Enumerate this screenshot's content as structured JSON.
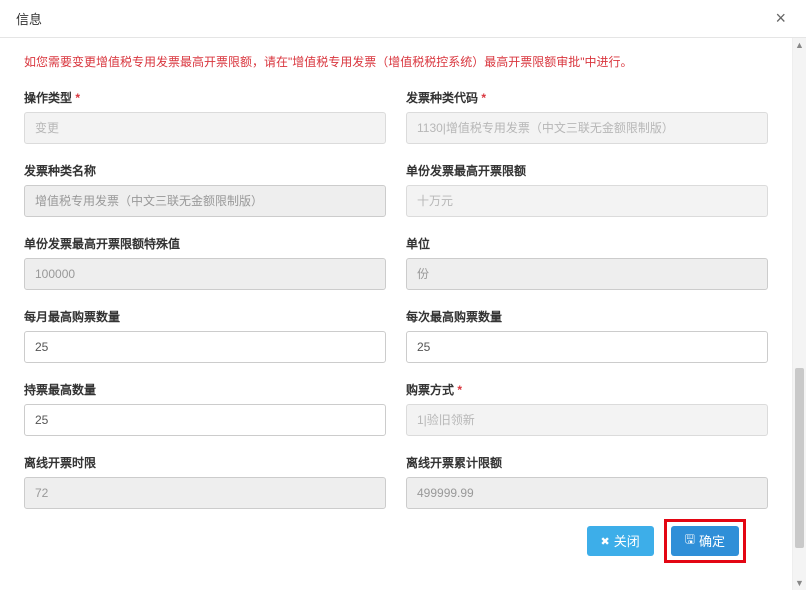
{
  "header": {
    "title": "信息"
  },
  "notice": "如您需要变更增值税专用发票最高开票限额，请在\"增值税专用发票（增值税税控系统）最高开票限额审批\"中进行。",
  "fields": {
    "opType": {
      "label": "操作类型",
      "value": "变更"
    },
    "invoiceCode": {
      "label": "发票种类代码",
      "value": "1130|增值税专用发票（中文三联无金额限制版）"
    },
    "invoiceName": {
      "label": "发票种类名称",
      "value": "增值税专用发票（中文三联无金额限制版）"
    },
    "maxLimit": {
      "label": "单份发票最高开票限额",
      "value": "十万元"
    },
    "maxLimitSpecial": {
      "label": "单份发票最高开票限额特殊值",
      "value": "100000"
    },
    "unit": {
      "label": "单位",
      "value": "份"
    },
    "monthlyMax": {
      "label": "每月最高购票数量",
      "value": "25"
    },
    "perTimeMax": {
      "label": "每次最高购票数量",
      "value": "25"
    },
    "holdMax": {
      "label": "持票最高数量",
      "value": "25"
    },
    "buyMethod": {
      "label": "购票方式",
      "value": "1|验旧领新"
    },
    "offlineHours": {
      "label": "离线开票时限",
      "value": "72"
    },
    "offlineTotal": {
      "label": "离线开票累计限额",
      "value": "499999.99"
    }
  },
  "buttons": {
    "cancel": "关闭",
    "confirm": "确定"
  }
}
